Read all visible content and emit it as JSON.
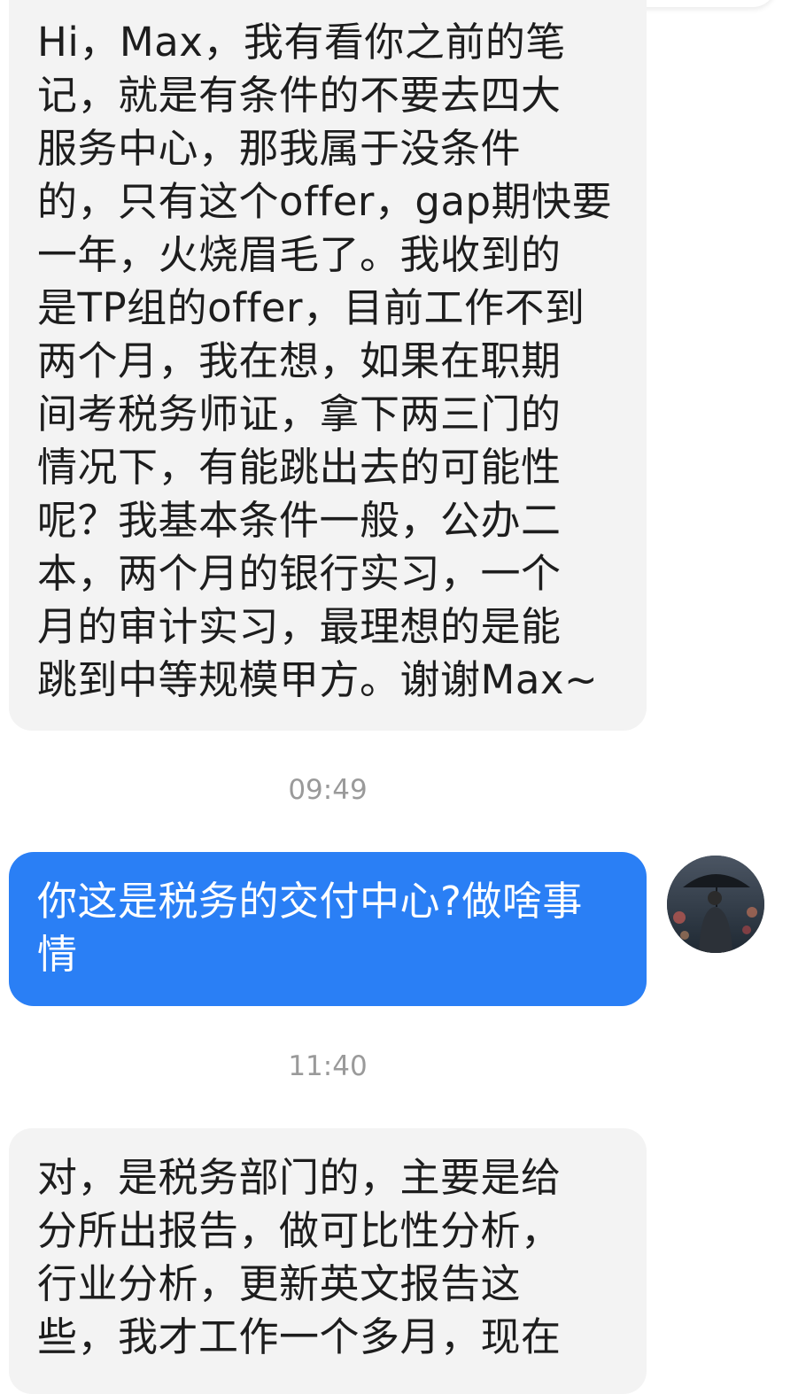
{
  "messages": [
    {
      "direction": "incoming",
      "text": "Hi，Max，我有看你之前的笔\n记，就是有条件的不要去四大\n服务中心，那我属于没条件\n的，只有这个offer，gap期快要\n一年，火烧眉毛了。我收到的\n是TP组的offer，目前工作不到\n两个月，我在想，如果在职期\n间考税务师证，拿下两三门的\n情况下，有能跳出去的可能性\n呢？我基本条件一般，公办二\n本，两个月的银行实习，一个\n月的审计实习，最理想的是能\n跳到中等规模甲方。谢谢Max~"
    },
    {
      "direction": "outgoing",
      "timestamp": "09:49",
      "text": "你这是税务的交付中心?做啥事\n情"
    },
    {
      "direction": "incoming",
      "timestamp": "11:40",
      "text": "对，是税务部门的，主要是给\n分所出报告，做可比性分析，\n行业分析，更新英文报告这\n些，我才工作一个多月，现在"
    }
  ],
  "colors": {
    "incoming_bubble": "#f3f3f3",
    "outgoing_bubble": "#2a7ff5",
    "timestamp_text": "#9a9a9a"
  },
  "avatar_icon": "user-avatar-umbrella-photo"
}
